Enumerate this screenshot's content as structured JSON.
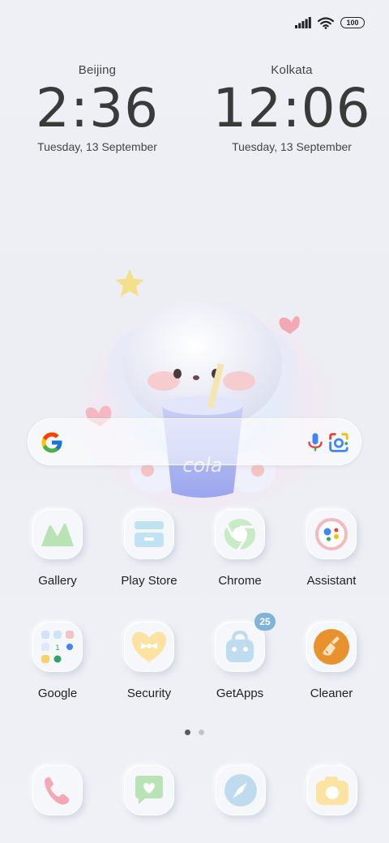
{
  "status_bar": {
    "battery": "100",
    "signal_icon": "signal-icon",
    "wifi_icon": "wifi-icon"
  },
  "clocks": [
    {
      "city": "Beijing",
      "time": "2:36",
      "date": "Tuesday, 13 September"
    },
    {
      "city": "Kolkata",
      "time": "12:06",
      "date": "Tuesday, 13 September"
    }
  ],
  "wallpaper": {
    "cup_text": "cola"
  },
  "search": {
    "logo_icon": "google-g-icon",
    "mic_icon": "mic-icon",
    "lens_icon": "google-lens-icon"
  },
  "apps_row1": [
    {
      "label": "Gallery",
      "icon": "gallery-icon"
    },
    {
      "label": "Play Store",
      "icon": "play-store-icon"
    },
    {
      "label": "Chrome",
      "icon": "chrome-icon"
    },
    {
      "label": "Assistant",
      "icon": "assistant-icon"
    }
  ],
  "apps_row2": [
    {
      "label": "Google",
      "icon": "google-folder-icon"
    },
    {
      "label": "Security",
      "icon": "security-icon"
    },
    {
      "label": "GetApps",
      "icon": "getapps-icon",
      "badge": "25"
    },
    {
      "label": "Cleaner",
      "icon": "cleaner-icon"
    }
  ],
  "page_indicator": {
    "pages": 2,
    "active": 1
  },
  "dock": [
    {
      "icon": "phone-icon"
    },
    {
      "icon": "messages-icon"
    },
    {
      "icon": "browser-icon"
    },
    {
      "icon": "camera-icon"
    }
  ],
  "colors": {
    "accent": "#7fb4d8",
    "cleaner": "#e8922e",
    "gallery": "#b9e3b5",
    "security": "#fde3a2"
  }
}
